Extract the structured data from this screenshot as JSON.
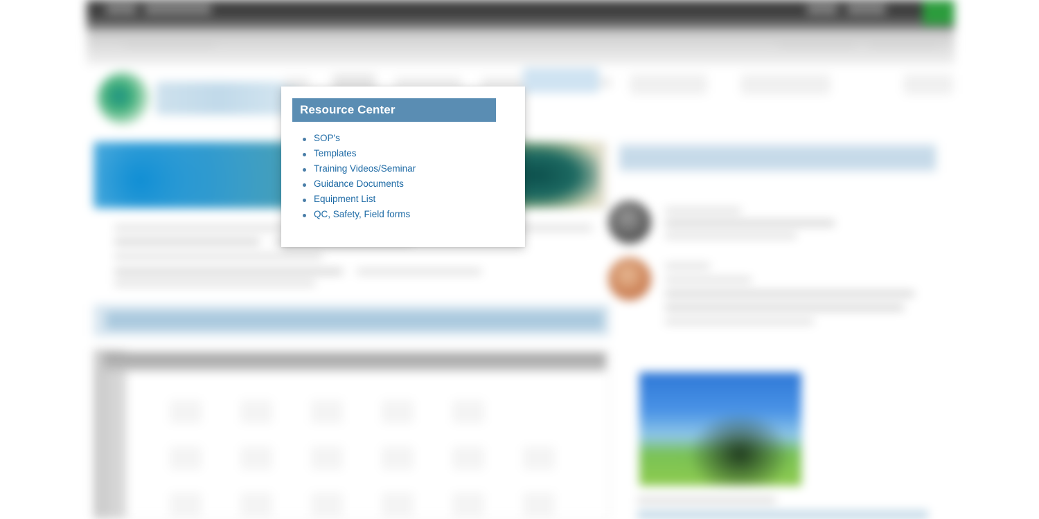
{
  "popup": {
    "title": "Resource Center",
    "items": [
      {
        "label": "SOP's"
      },
      {
        "label": "Templates"
      },
      {
        "label": "Training Videos/Seminar"
      },
      {
        "label": "Guidance Documents"
      },
      {
        "label": "Equipment List"
      },
      {
        "label": "QC, Safety, Field forms"
      }
    ]
  },
  "colors": {
    "popup_header_bg": "#5a8db3",
    "popup_link": "#1d6aa5",
    "bullet": "#4a7ea8",
    "topbar_bg": "#3f3f3f",
    "topbar_accent_green": "#2c9c3d",
    "section_bar_blue": "#aac9de",
    "brand_green": "#3fae7a"
  },
  "background": {
    "topbar": {
      "name": "site-utility-bar"
    },
    "logo": {
      "name": "site-logo"
    },
    "nav": {
      "name": "main-navigation"
    },
    "hero": {
      "name": "hero-banner-image"
    },
    "article": {
      "name": "article-body"
    },
    "calendar": {
      "name": "calendar-widget"
    },
    "sidebar": {
      "name": "news-sidebar"
    },
    "thumbnail": {
      "name": "sidebar-photo"
    }
  }
}
